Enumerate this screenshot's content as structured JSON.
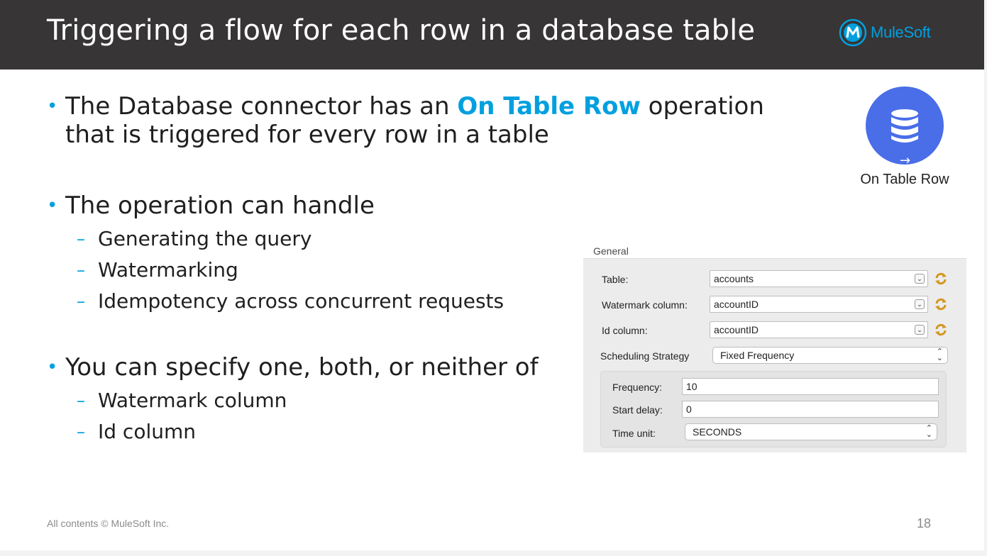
{
  "header": {
    "title": "Triggering a flow for each row in a database table",
    "logo_text": "MuleSoft",
    "logo_letter": "M"
  },
  "bullets": {
    "b1_prefix": "The Database connector has an ",
    "b1_highlight": "On Table Row",
    "b1_suffix": " operation that is triggered for every row in a table",
    "b2": "The operation can handle",
    "b2_subs": [
      "Generating the query",
      "Watermarking",
      "Idempotency across concurrent requests"
    ],
    "b3": "You can specify one, both, or neither of",
    "b3_subs": [
      "Watermark column",
      "Id column"
    ],
    "bullet_glyph": "•",
    "dash_glyph": "–"
  },
  "icon": {
    "name": "database-icon",
    "label": "On Table Row",
    "arrow_glyph": "→",
    "color": "#4a6ee8"
  },
  "panel": {
    "section_label": "General",
    "table_label": "Table:",
    "table_value": "accounts",
    "watermark_label": "Watermark column:",
    "watermark_value": "accountID",
    "id_label": "Id column:",
    "id_value": "accountID",
    "scheduling_label": "Scheduling Strategy",
    "scheduling_value": "Fixed Frequency",
    "frequency_label": "Frequency:",
    "frequency_value": "10",
    "start_delay_label": "Start delay:",
    "start_delay_value": "0",
    "time_unit_label": "Time unit:",
    "time_unit_value": "SECONDS",
    "caret_glyph": "⌄",
    "updown_glyph": "⌃⌄"
  },
  "footer": {
    "copyright": "All contents © MuleSoft Inc.",
    "page_number": "18"
  },
  "colors": {
    "accent": "#00a0df",
    "header_bg": "#373535",
    "icon_circle": "#4a6ee8"
  }
}
